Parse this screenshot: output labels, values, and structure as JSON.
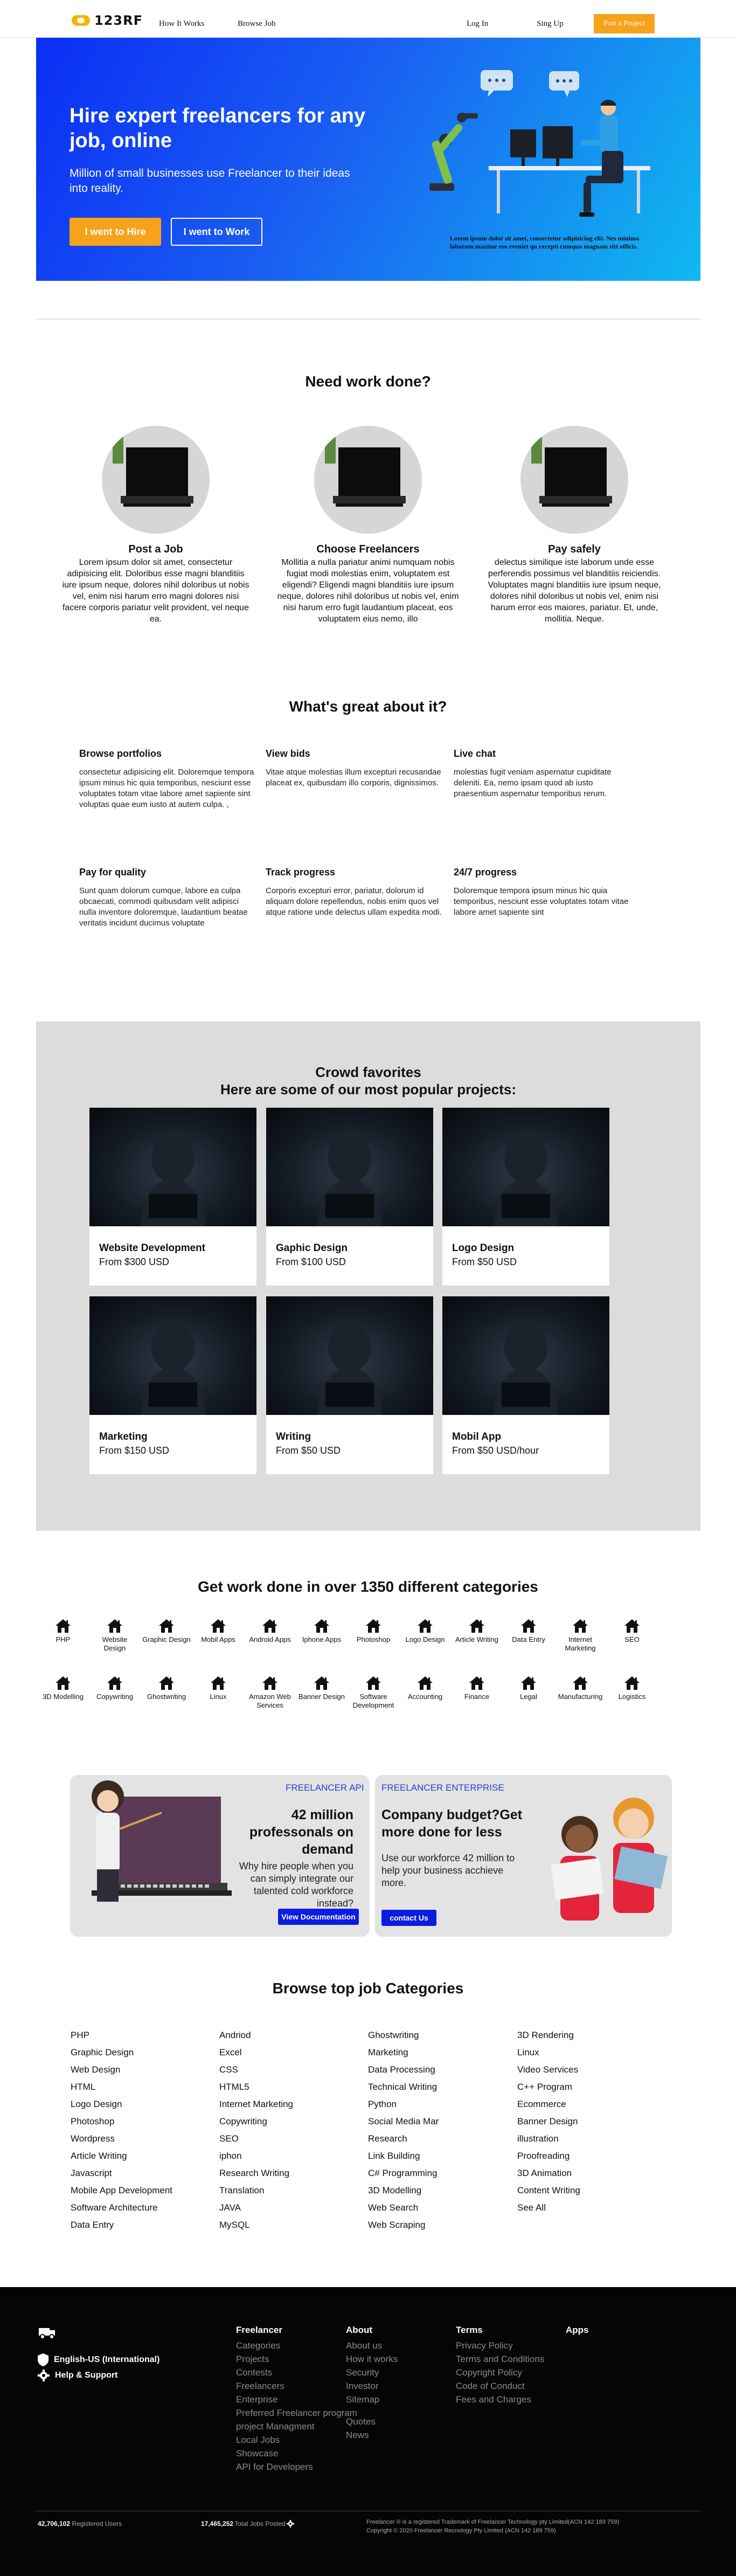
{
  "nav": {
    "logo_text": "123RF",
    "how_it_works": "How It Works",
    "browse_job": "Browse Job",
    "login": "Log In",
    "signup": "Sing Up",
    "post_project": "Post a Project"
  },
  "hero": {
    "title": "Hire expert freelancers for any job, online",
    "subtitle": "Million of small businesses use Freelancer to their ideas into reality.",
    "hire_btn": "I went to Hire",
    "work_btn": "I went to Work",
    "caption": "Lorem ipsum dolor sit amet, consectetur adipisicing elit. Nes minima laborum maxime eos eveniet qu excepti cumqua magnam sitt officis."
  },
  "need_work": {
    "title": "Need work done?",
    "steps": [
      {
        "title": "Post a Job",
        "text": "Lorem ipsum dolor sit amet, consectetur adipisicing elit. Doloribus esse magni blanditiis iure ipsum neque, dolores nihil doloribus ut nobis vel, enim nisi harum erro magni dolores nisi facere corporis pariatur velit provident, vel neque ea."
      },
      {
        "title": "Choose Freelancers",
        "text": "Mollitia a nulla pariatur animi numquam nobis fugiat modi molestias enim, voluptatem est eligendi? Eligendi magni blanditiis iure ipsum neque, dolores nihil doloribus ut nobis vel, enim nisi harum erro fugit laudantium placeat, eos voluptatem eius nemo, illo"
      },
      {
        "title": "Pay safely",
        "text": "delectus similique iste laborum unde esse perferendis possimus vel blanditiis reiciendis. Voluptates magni blanditiis iure ipsum neque, dolores nihil doloribus ut nobis vel, enim nisi harum error eos maiores, pariatur. Et, unde, mollitia. Neque."
      }
    ]
  },
  "great": {
    "title": "What's great about it?",
    "items": [
      {
        "title": "Browse portfolios",
        "text": "consectetur adipisicing elit. Doloremque tempora ipsum minus hic quia temporibus, nesciunt esse voluptates totam vitae labore amet sapiente sint voluptas quae eum iusto at autem culpa. ,"
      },
      {
        "title": "View bids",
        "text": "Vitae atque molestias illum excepturi recusandae placeat ex, quibusdam illo corporis, dignissimos."
      },
      {
        "title": "Live chat",
        "text": "molestias fugit veniam aspernatur cupiditate deleniti. Ea, nemo ipsam quod ab iusto praesentium aspernatur temporibus rerum."
      },
      {
        "title": "Pay for quality",
        "text": "Sunt quam dolorum cumque, labore ea culpa obcaecati, commodi quibusdam velit adipisci nulla inventore doloremque, laudantium beatae veritatis incidunt ducimus voluptate"
      },
      {
        "title": "Track progress",
        "text": "Corporis excepturi error, pariatur, dolorum id aliquam dolore repellendus, nobis enim quos vel atque ratione unde delectus ullam expedita modi."
      },
      {
        "title": "24/7 progress",
        "text": "Doloremque tempora ipsum minus hic quia temporibus, nesciunt esse voluptates totam vitae labore amet sapiente sint"
      }
    ]
  },
  "crowd": {
    "title": "Crowd favorites",
    "subtitle": "Here are some of our most popular projects:",
    "cards": [
      {
        "title": "Website Development",
        "price": "From $300 USD"
      },
      {
        "title": "Gaphic Design",
        "price": "From $100 USD"
      },
      {
        "title": "Logo Design",
        "price": "From $50 USD"
      },
      {
        "title": "Marketing",
        "price": "From $150 USD"
      },
      {
        "title": "Writing",
        "price": "From $50 USD"
      },
      {
        "title": "Mobil App",
        "price": "From $50 USD/hour"
      }
    ]
  },
  "categories": {
    "title": "Get work done in over 1350 different categories",
    "row1": [
      "PHP",
      "Website Design",
      "Graphic Design",
      "Mobil Apps",
      "Android Apps",
      "Iphone Apps",
      "Photoshop",
      "Logo Design",
      "Article Writing",
      "Data Entry",
      "Internet Marketing",
      "SEO"
    ],
    "row2": [
      "3D Modelling",
      "Copywriting",
      "Ghostwriting",
      "Linux",
      "Amazon Web Services",
      "Banner Design",
      "Software Development",
      "Accounting",
      "Finance",
      "Legal",
      "Manufacturing",
      "Logistics"
    ]
  },
  "promo": {
    "left": {
      "tag": "FREELANCER API",
      "title": "42 million professonals on demand",
      "desc": "Why hire people when you can simply integrate our talented cold workforce instead?",
      "button": "View Documentation"
    },
    "right": {
      "tag": "FREELANCER ENTERPRISE",
      "title": "Company budget?Get more done for less",
      "desc": "Use our workforce 42 million to help your business acchieve more.",
      "button": "contact Us"
    }
  },
  "top_jobs": {
    "title": "Browse top job Categories",
    "col1": [
      "PHP",
      "Graphic Design",
      "Web Design",
      "HTML",
      "Logo Design",
      "Photoshop",
      "Wordpress",
      "Article Writing",
      "Javascript",
      "Mobile App Development",
      "Software Architecture",
      "Data Entry"
    ],
    "col2": [
      "Andriod",
      "Excel",
      "CSS",
      "HTML5",
      "Internet Marketing",
      "Copywriting",
      "SEO",
      "iphon",
      "Research Writing",
      "Translation",
      "JAVA",
      "MySQL"
    ],
    "col3": [
      "Ghostwriting",
      "Marketing",
      "Data Processing",
      "Technical Writing",
      "Python",
      "Social Media Mar",
      "Research",
      "Link Building",
      "C# Programming",
      "3D Modelling",
      "Web Search",
      "Web Scraping"
    ],
    "col4": [
      "3D Rendering",
      "Linux",
      "Video Services",
      "C++ Program",
      "Ecommerce",
      "Banner Design",
      "illustration",
      "Proofreading",
      "3D Animation",
      "Content Writing",
      "See All"
    ]
  },
  "footer": {
    "language": "English-US (International)",
    "help": "Help & Support",
    "freelancer": {
      "heading": "Freelancer",
      "links": [
        "Categories",
        "Projects",
        "Contests",
        "Freelancers",
        "Enterprise",
        "Preferred Freelancer program",
        "project Managment",
        "Local Jobs",
        "Showcase",
        "API for Developers"
      ]
    },
    "about": {
      "heading": "About",
      "links": [
        "About us",
        "How it works",
        "Security",
        "Investor",
        "Sitemap",
        "Quotes",
        "News"
      ]
    },
    "terms": {
      "heading": "Terms",
      "links": [
        "Privacy Policy",
        "Terms and Conditions",
        "Copyright Policy",
        "Code of Conduct",
        "Fees and Charges"
      ]
    },
    "apps": {
      "heading": "Apps"
    },
    "registered_count": "42,706,102",
    "registered_label": "Registered Users",
    "jobs_count": "17,465,252",
    "jobs_label": "Total Jobs Posted",
    "legal_1": "Freelancer ® is a registered Trademark of Freelancer Technology pty Limited(ACN 142 189 759)",
    "legal_2": "Copyright © 2020 Freelancer Recnology Pty Limited (ACN 142 189 759)"
  },
  "colors": {
    "accent_orange": "#f7a21b",
    "hero_blue": "#0b2ef5",
    "hero_cyan": "#10b9f0",
    "button_blue": "#0b1de0",
    "panel_gray": "#dcdcdc",
    "footer_bg": "#050505"
  }
}
